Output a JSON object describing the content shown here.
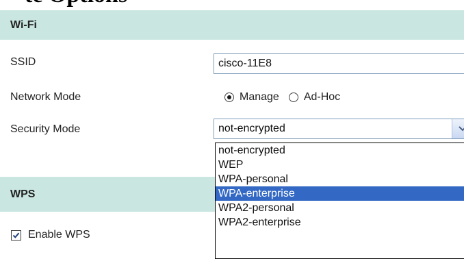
{
  "page": {
    "title_fragment": "te Options"
  },
  "wifi": {
    "section_title": "Wi-Fi",
    "ssid": {
      "label": "SSID",
      "value": "cisco-11E8"
    },
    "network_mode": {
      "label": "Network Mode",
      "options": [
        {
          "label": "Manage",
          "selected": true
        },
        {
          "label": "Ad-Hoc",
          "selected": false
        }
      ]
    },
    "security_mode": {
      "label": "Security Mode",
      "selected_value": "not-encrypted",
      "options": [
        "not-encrypted",
        "WEP",
        "WPA-personal",
        "WPA-enterprise",
        "WPA2-personal",
        "WPA2-enterprise"
      ],
      "highlighted_option": "WPA-enterprise"
    }
  },
  "wps": {
    "section_title": "WPS",
    "enable": {
      "label": "Enable WPS",
      "checked": true
    }
  },
  "colors": {
    "section_header_bg": "#c9e6e0",
    "dropdown_highlight": "#3369c4",
    "input_border": "#7f9db9"
  }
}
